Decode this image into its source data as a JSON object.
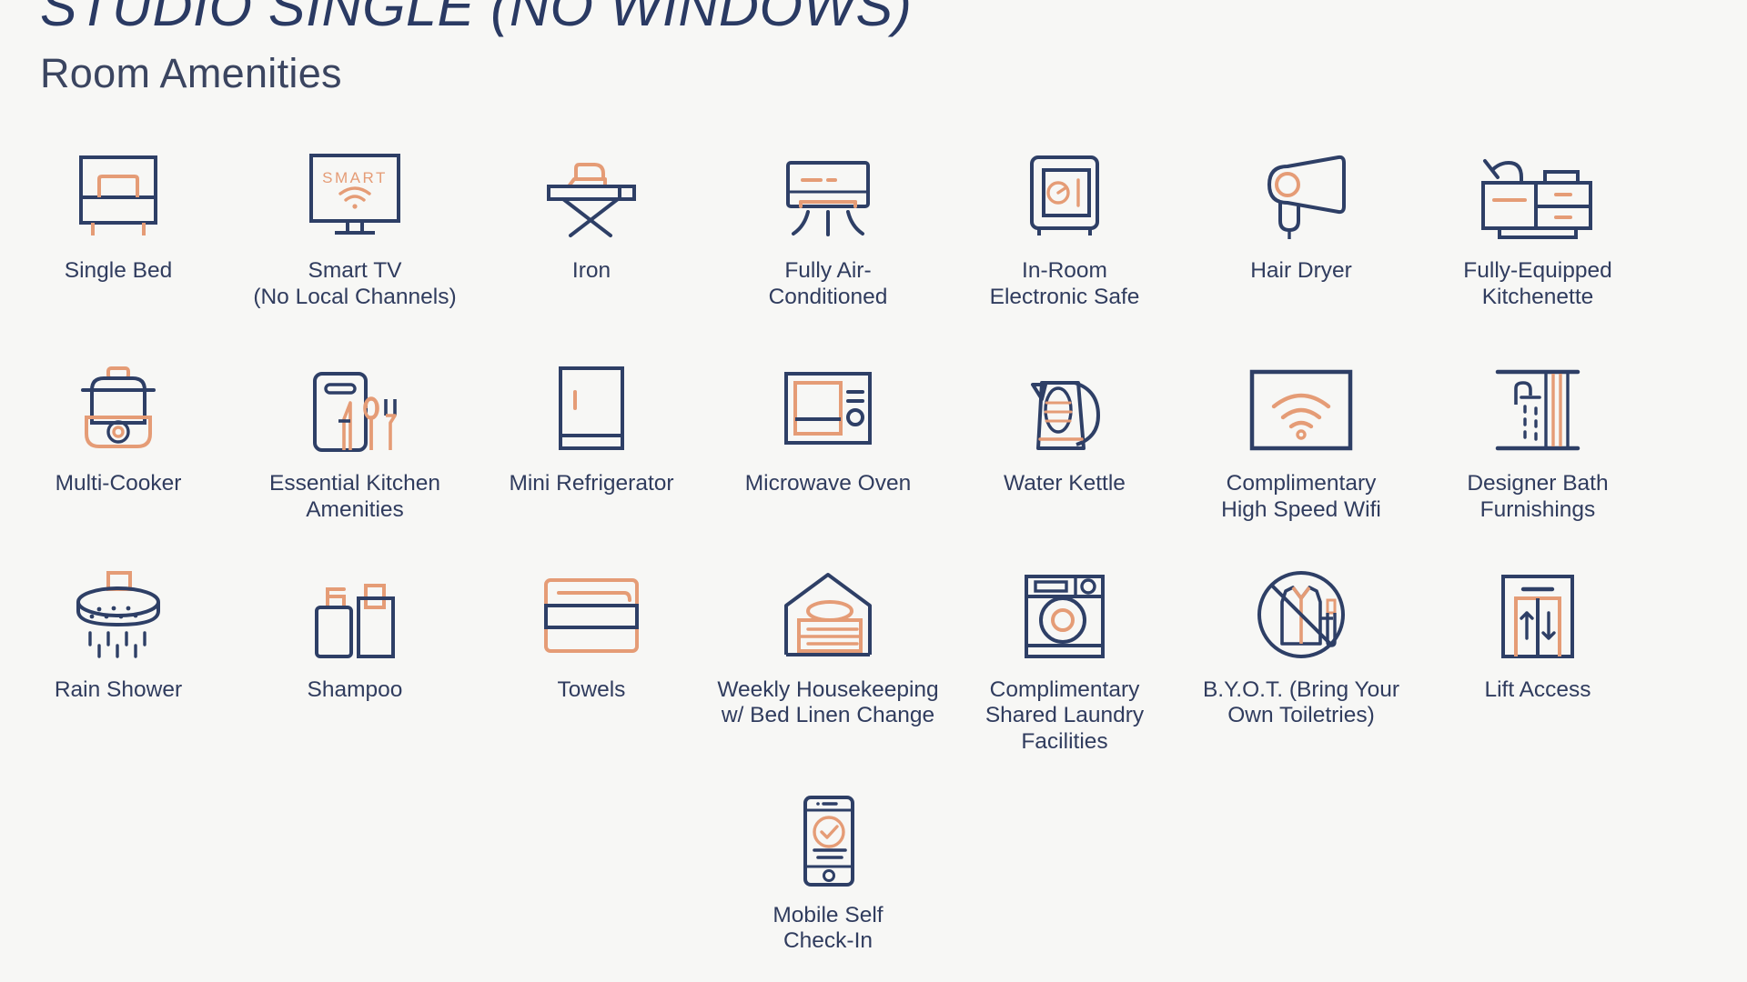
{
  "header": {
    "title": "STUDIO SINGLE (NO WINDOWS)",
    "subtitle": "Room Amenities"
  },
  "colors": {
    "navy": "#2e3f66",
    "orange": "#e59c76",
    "background": "#f7f7f5",
    "text": "#303c5e"
  },
  "amenities": {
    "rows": [
      [
        {
          "icon": "single-bed-icon",
          "label": "Single Bed"
        },
        {
          "icon": "smart-tv-icon",
          "label": "Smart TV\n(No Local Channels)",
          "icon_text": "SMART"
        },
        {
          "icon": "iron-icon",
          "label": "Iron"
        },
        {
          "icon": "air-conditioner-icon",
          "label": "Fully Air-\nConditioned"
        },
        {
          "icon": "safe-icon",
          "label": "In-Room\nElectronic Safe"
        },
        {
          "icon": "hair-dryer-icon",
          "label": "Hair Dryer"
        },
        {
          "icon": "kitchenette-icon",
          "label": "Fully-Equipped\nKitchenette"
        }
      ],
      [
        {
          "icon": "multi-cooker-icon",
          "label": "Multi-Cooker"
        },
        {
          "icon": "cutlery-board-icon",
          "label": "Essential Kitchen\nAmenities"
        },
        {
          "icon": "mini-refrigerator-icon",
          "label": "Mini Refrigerator"
        },
        {
          "icon": "microwave-oven-icon",
          "label": "Microwave Oven"
        },
        {
          "icon": "water-kettle-icon",
          "label": "Water Kettle"
        },
        {
          "icon": "wifi-icon",
          "label": "Complimentary\nHigh Speed Wifi"
        },
        {
          "icon": "shower-curtain-icon",
          "label": "Designer Bath\nFurnishings"
        }
      ],
      [
        {
          "icon": "rain-shower-icon",
          "label": "Rain Shower"
        },
        {
          "icon": "shampoo-bottles-icon",
          "label": "Shampoo"
        },
        {
          "icon": "folded-towels-icon",
          "label": "Towels"
        },
        {
          "icon": "housekeeping-linen-icon",
          "label": "Weekly Housekeeping\nw/ Bed Linen Change"
        },
        {
          "icon": "washing-machine-icon",
          "label": "Complimentary\nShared Laundry\nFacilities"
        },
        {
          "icon": "no-toiletries-icon",
          "label": "B.Y.O.T. (Bring Your\nOwn Toiletries)"
        },
        {
          "icon": "lift-access-icon",
          "label": "Lift Access"
        }
      ],
      [
        {
          "icon": "mobile-checkin-icon",
          "label": "Mobile Self\nCheck-In"
        }
      ]
    ]
  }
}
